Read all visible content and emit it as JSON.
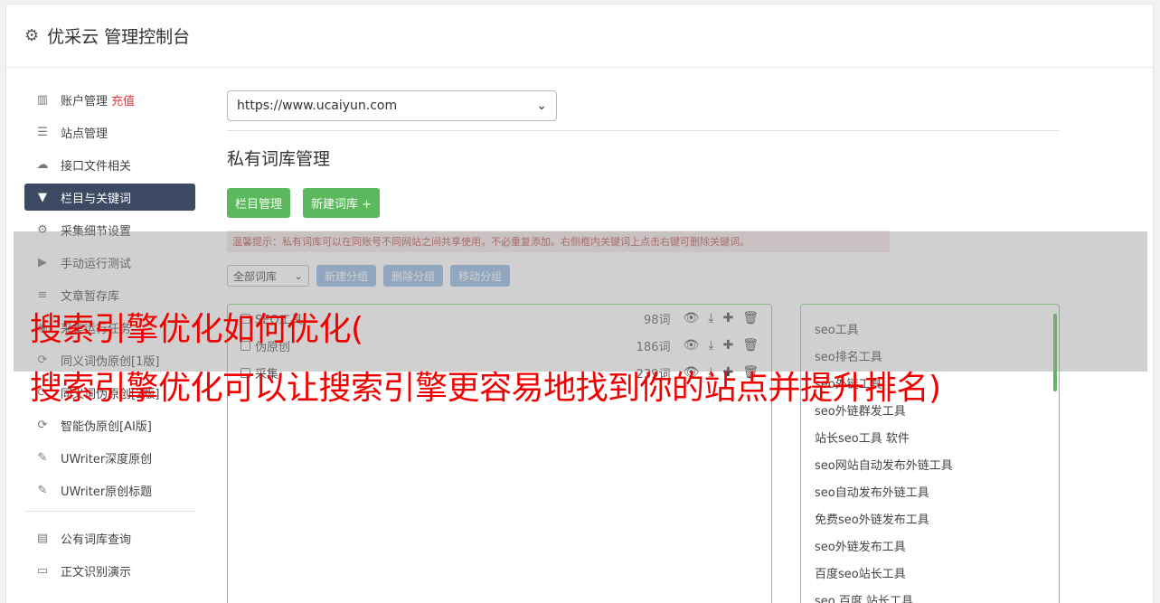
{
  "header": {
    "title": "优采云 管理控制台",
    "icon": "gear-icon"
  },
  "sidebar": {
    "items": [
      {
        "label": "账户管理",
        "badge": "充值",
        "icon": "bar-chart-icon"
      },
      {
        "label": "站点管理",
        "icon": "server-icon"
      },
      {
        "label": "接口文件相关",
        "icon": "cloud-upload-icon"
      },
      {
        "label": "栏目与关键词",
        "icon": "filter-icon",
        "active": true
      },
      {
        "label": "采集细节设置",
        "icon": "cogs-icon"
      },
      {
        "label": "手动运行测试",
        "icon": "play-icon"
      },
      {
        "label": "文章暂存库",
        "icon": "database-icon"
      },
      {
        "label": "采集运行任务",
        "icon": "tasks-icon"
      },
      {
        "label": "同义词伪原创[1版]",
        "icon": "refresh-icon"
      },
      {
        "label": "同义词伪原创[2版]",
        "icon": "refresh-icon"
      },
      {
        "label": "智能伪原创[AI版]",
        "icon": "refresh-icon"
      },
      {
        "label": "UWriter深度原创",
        "icon": "edit-icon"
      },
      {
        "label": "UWriter原创标题",
        "icon": "edit-icon"
      }
    ],
    "items2": [
      {
        "label": "公有词库查询",
        "icon": "book-icon"
      },
      {
        "label": "正文识别演示",
        "icon": "monitor-icon"
      }
    ]
  },
  "main": {
    "site_select": "https://www.ucaiyun.com",
    "section_title": "私有词库管理",
    "btn_columns": "栏目管理",
    "btn_new_lib": "新建词库 +",
    "tip": "温馨提示：私有词库可以在同账号不同网站之间共享使用，不必重复添加。右侧框内关键词上点击右键可删除关键词。",
    "group_select": "全部词库",
    "btn_new_group": "新建分组",
    "btn_delete_group": "删除分组",
    "btn_move_group": "移动分组",
    "libraries": [
      {
        "name": "SEO工具",
        "count": "98词"
      },
      {
        "name": "伪原创",
        "count": "186词"
      },
      {
        "name": "采集",
        "count": "239词"
      }
    ],
    "keywords": [
      "seo工具",
      "seo排名工具",
      "seo外链工具",
      "seo外链群发工具",
      "站长seo工具 软件",
      "seo网站自动发布外链工具",
      "seo自动发布外链工具",
      "免费seo外链发布工具",
      "seo外链发布工具",
      "百度seo站长工具",
      "seo 百度 站长工具"
    ]
  },
  "overlay": {
    "line1": "搜索引擎优化如何优化(",
    "line2": "搜索引擎优化可以让搜索引擎更容易地找到你的站点并提升排名)"
  }
}
